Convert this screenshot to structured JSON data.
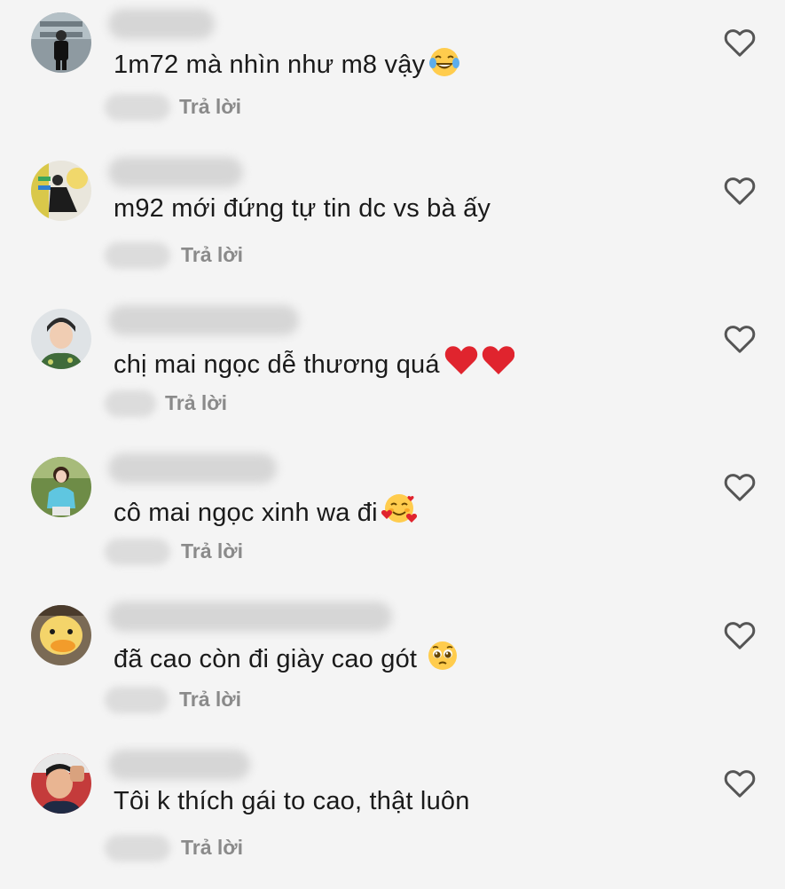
{
  "reply_label": "Trả lời",
  "comments": [
    {
      "text": "1m72 mà nhìn như m8 vậy",
      "emoji": "joy-emoji"
    },
    {
      "text": "m92 mới đứng tự tin dc vs bà ấy",
      "emoji": ""
    },
    {
      "text": "chị mai ngọc dễ thương quá",
      "emoji": "red-heart-emoji"
    },
    {
      "text": "cô mai ngọc xinh wa đi",
      "emoji": "smiling-face-with-hearts-emoji"
    },
    {
      "text": "đã cao còn đi giày cao gót",
      "emoji": "pleading-face-emoji"
    },
    {
      "text": "Tôi k thích gái to cao, thật luôn",
      "emoji": ""
    }
  ],
  "icons": {
    "like": "heart-outline-icon"
  },
  "colors": {
    "background": "#f4f4f4",
    "text": "#1a1a1a",
    "reply": "#8a8a8a",
    "icon": "#555555"
  }
}
